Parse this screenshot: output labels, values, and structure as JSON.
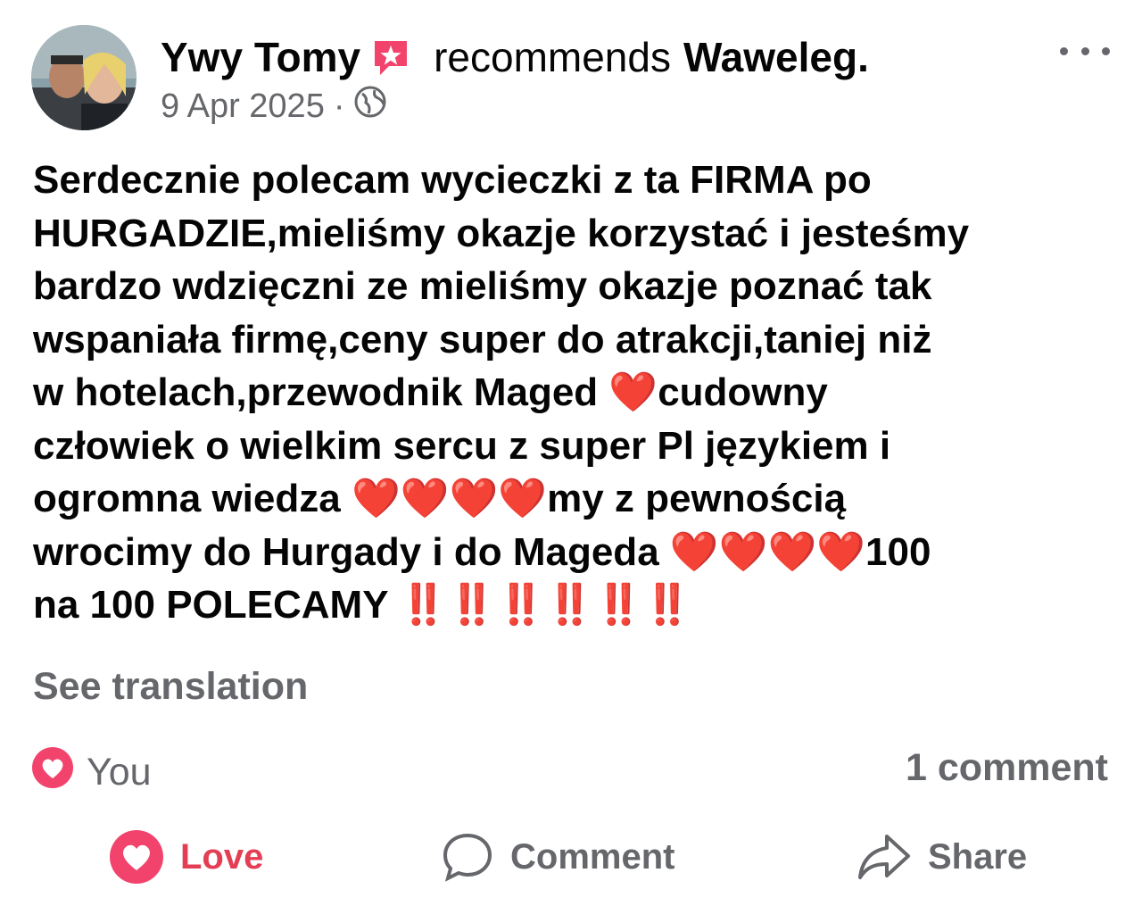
{
  "post": {
    "author": "Ywy Tomy",
    "action_text": "recommends",
    "page_name": "Waweleg.",
    "date": "9 Apr 2025",
    "separator": "·",
    "audience_icon": "globe-icon",
    "more_icon": "more-options-icon",
    "body": "Serdecznie polecam wycieczki z ta FIRMA po\nHURGADZIE,mieliśmy okazje korzystać i jesteśmy\nbardzo wdzięczni ze mieliśmy okazje poznać tak\nwspaniała firmę,ceny super do atrakcji,taniej niż\nw hotelach,przewodnik Maged ❤️cudowny\nczłowiek o wielkim sercu z super Pl językiem i\nogromna wiedza ❤️❤️❤️❤️my z pewnością\nwrocimy do Hurgady i do Mageda ❤️❤️❤️❤️100\nna 100 POLECAMY ‼️‼️‼️‼️‼️‼️",
    "see_translation": "See translation"
  },
  "reactions": {
    "icon": "love-reaction-icon",
    "label": "You",
    "comment_count": "1 comment"
  },
  "actions": {
    "love": "Love",
    "comment": "Comment",
    "share": "Share"
  },
  "colors": {
    "text": "#050505",
    "secondary": "#65676b",
    "love": "#e43e55",
    "badge": "#f2436c"
  }
}
